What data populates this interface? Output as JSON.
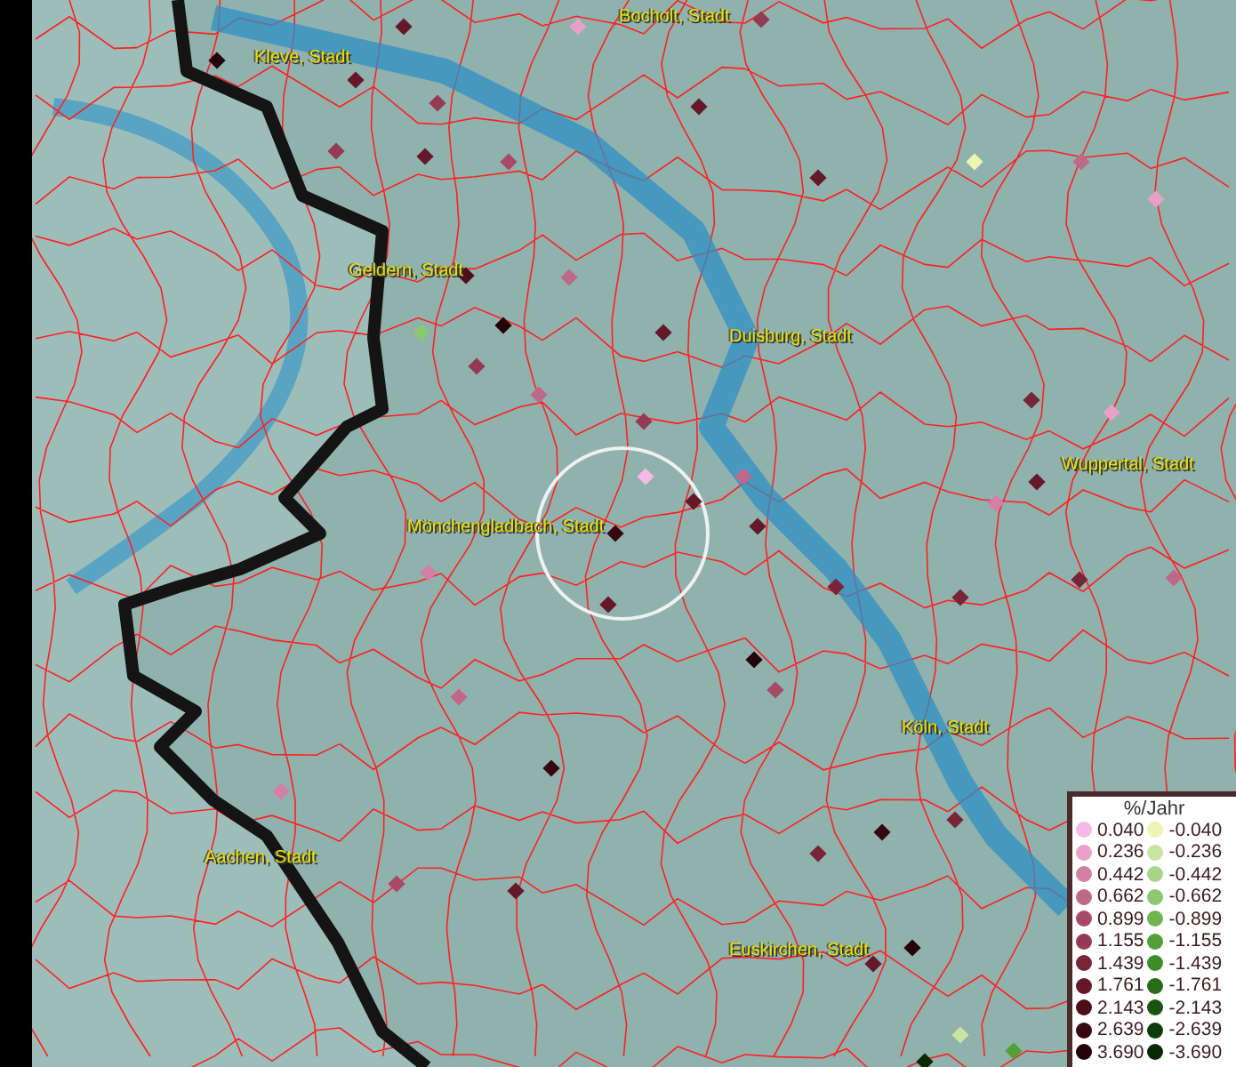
{
  "map": {
    "cities": [
      {
        "name": "Bocholt, Stadt"
      },
      {
        "name": "Kleve, Stadt"
      },
      {
        "name": "Geldern, Stadt"
      },
      {
        "name": "Duisburg, Stadt"
      },
      {
        "name": "Wuppertal, Stadt"
      },
      {
        "name": "Mönchengladbach, Stadt"
      },
      {
        "name": "Köln, Stadt"
      },
      {
        "name": "Aachen, Stadt"
      },
      {
        "name": "Euskirchen, Stadt"
      }
    ],
    "points": [
      {
        "color": "#661828"
      },
      {
        "color": "#e8a0c8"
      },
      {
        "color": "#943a52"
      },
      {
        "color": "#240408"
      },
      {
        "color": "#661828"
      },
      {
        "color": "#943a52"
      },
      {
        "color": "#943a52"
      },
      {
        "color": "#661828"
      },
      {
        "color": "#a84a66"
      },
      {
        "color": "#661828"
      },
      {
        "color": "#c06888"
      },
      {
        "color": "#4e0e18"
      },
      {
        "color": "#8cc870"
      },
      {
        "color": "#240408"
      },
      {
        "color": "#661828"
      },
      {
        "color": "#661828"
      },
      {
        "color": "#eef5b0"
      },
      {
        "color": "#c06888"
      },
      {
        "color": "#e8a0c8"
      },
      {
        "color": "#943a52"
      },
      {
        "color": "#c06888"
      },
      {
        "color": "#943a52"
      },
      {
        "color": "#c06888"
      },
      {
        "color": "#f5b8e8"
      },
      {
        "color": "#661828"
      },
      {
        "color": "#380810"
      },
      {
        "color": "#661828"
      },
      {
        "color": "#661828"
      },
      {
        "color": "#d47fa5"
      },
      {
        "color": "#c06888"
      },
      {
        "color": "#a84a66"
      },
      {
        "color": "#240408"
      },
      {
        "color": "#7a2438"
      },
      {
        "color": "#7a2438"
      },
      {
        "color": "#d47fa5"
      },
      {
        "color": "#661828"
      },
      {
        "color": "#7a2438"
      },
      {
        "color": "#c06888"
      },
      {
        "color": "#a84a66"
      },
      {
        "color": "#d47fa5"
      },
      {
        "color": "#661828"
      },
      {
        "color": "#380810"
      },
      {
        "color": "#240408"
      },
      {
        "color": "#7a2438"
      },
      {
        "color": "#661828"
      },
      {
        "color": "#c8e6a0"
      },
      {
        "color": "#52a038"
      },
      {
        "color": "#082806"
      },
      {
        "color": "#380810"
      },
      {
        "color": "#7a2438"
      },
      {
        "color": "#7a2438"
      },
      {
        "color": "#e8a0c8"
      }
    ]
  },
  "legend": {
    "title": "%/Jahr",
    "positive": [
      {
        "label": "0.040",
        "color": "#f5b8e8"
      },
      {
        "label": "0.236",
        "color": "#e8a0c8"
      },
      {
        "label": "0.442",
        "color": "#d47fa5"
      },
      {
        "label": "0.662",
        "color": "#c06888"
      },
      {
        "label": "0.899",
        "color": "#a84a66"
      },
      {
        "label": "1.155",
        "color": "#943a52"
      },
      {
        "label": "1.439",
        "color": "#7a2438"
      },
      {
        "label": "1.761",
        "color": "#661828"
      },
      {
        "label": "2.143",
        "color": "#4e0e18"
      },
      {
        "label": "2.639",
        "color": "#380810"
      },
      {
        "label": "3.690",
        "color": "#240408"
      }
    ],
    "negative": [
      {
        "label": "-0.040",
        "color": "#eef5b0"
      },
      {
        "label": "-0.236",
        "color": "#c8e6a0"
      },
      {
        "label": "-0.442",
        "color": "#a8d488"
      },
      {
        "label": "-0.662",
        "color": "#8cc870"
      },
      {
        "label": "-0.899",
        "color": "#6eb450"
      },
      {
        "label": "-1.155",
        "color": "#52a038"
      },
      {
        "label": "-1.439",
        "color": "#3c8c28"
      },
      {
        "label": "-1.761",
        "color": "#286c18"
      },
      {
        "label": "-2.143",
        "color": "#1a5410"
      },
      {
        "label": "-2.639",
        "color": "#0e3c08"
      },
      {
        "label": "-3.690",
        "color": "#082806"
      }
    ]
  }
}
